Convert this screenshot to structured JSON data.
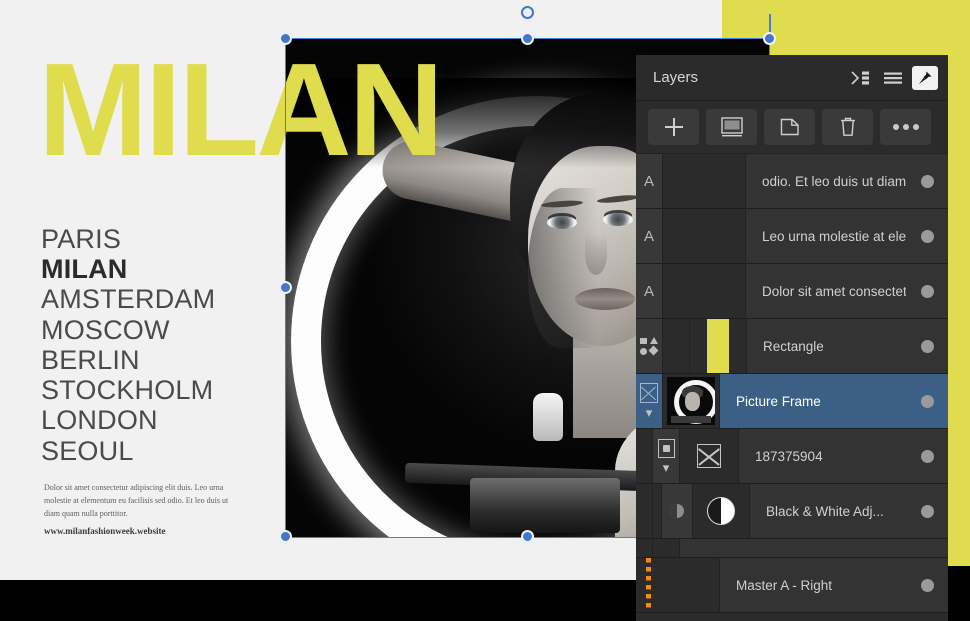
{
  "poster": {
    "title": "MILAN",
    "title_color": "#dfdc4e",
    "accent_block_color": "#dfdc4e",
    "background_color": "#f0f1f0",
    "cities": [
      {
        "name": "PARIS",
        "active": false
      },
      {
        "name": "MILAN",
        "active": true
      },
      {
        "name": "AMSTERDAM",
        "active": false
      },
      {
        "name": "MOSCOW",
        "active": false
      },
      {
        "name": "BERLIN",
        "active": false
      },
      {
        "name": "STOCKHOLM",
        "active": false
      },
      {
        "name": "LONDON",
        "active": false
      },
      {
        "name": "SEOUL",
        "active": false
      }
    ],
    "body_text": "Dolor sit amet consectetur adipiscing elit duis. Leo urna molestie at elementum eu facilisis sed odio. Et leo duis ut diam quam nulla porttitor.",
    "url": "www.milanfashionweek.website"
  },
  "selection": {
    "handle_color": "#4477cc",
    "outline_color": "#4a7fd0",
    "rotation_handle": "rotate-handle"
  },
  "panel": {
    "title": "Layers",
    "header_icons": [
      {
        "name": "collapse-panel-icon"
      },
      {
        "name": "panel-menu-icon"
      },
      {
        "name": "pin-panel-icon"
      }
    ],
    "toolbar": [
      {
        "name": "add-layer-button",
        "icon": "plus-icon"
      },
      {
        "name": "add-mask-button",
        "icon": "mask-icon"
      },
      {
        "name": "duplicate-layer-button",
        "icon": "duplicate-icon"
      },
      {
        "name": "delete-layer-button",
        "icon": "trash-icon"
      },
      {
        "name": "more-options-button",
        "icon": "ellipsis-icon"
      }
    ],
    "selected_row_color": "#3c5f86",
    "layers": [
      {
        "label": "odio. Et leo duis ut diam",
        "icon": "text-layer-icon",
        "type": "text",
        "selected": false
      },
      {
        "label": "Leo urna molestie at elem",
        "icon": "text-layer-icon",
        "type": "text",
        "selected": false
      },
      {
        "label": "Dolor sit amet consectetu",
        "icon": "text-layer-icon",
        "type": "text",
        "selected": false
      },
      {
        "label": "Rectangle",
        "icon": "shape-layer-icon",
        "type": "shape",
        "selected": false
      },
      {
        "label": "Picture Frame",
        "icon": "picture-frame-icon",
        "type": "frame",
        "selected": true
      },
      {
        "label": "187375904",
        "icon": "image-layer-icon",
        "type": "image",
        "selected": false
      },
      {
        "label": "Black & White Adj...",
        "icon": "black-white-adjustment-icon",
        "type": "adjustment",
        "selected": false
      },
      {
        "label": "Master A - Right",
        "icon": "master-page-icon",
        "type": "master",
        "selected": false
      }
    ]
  }
}
